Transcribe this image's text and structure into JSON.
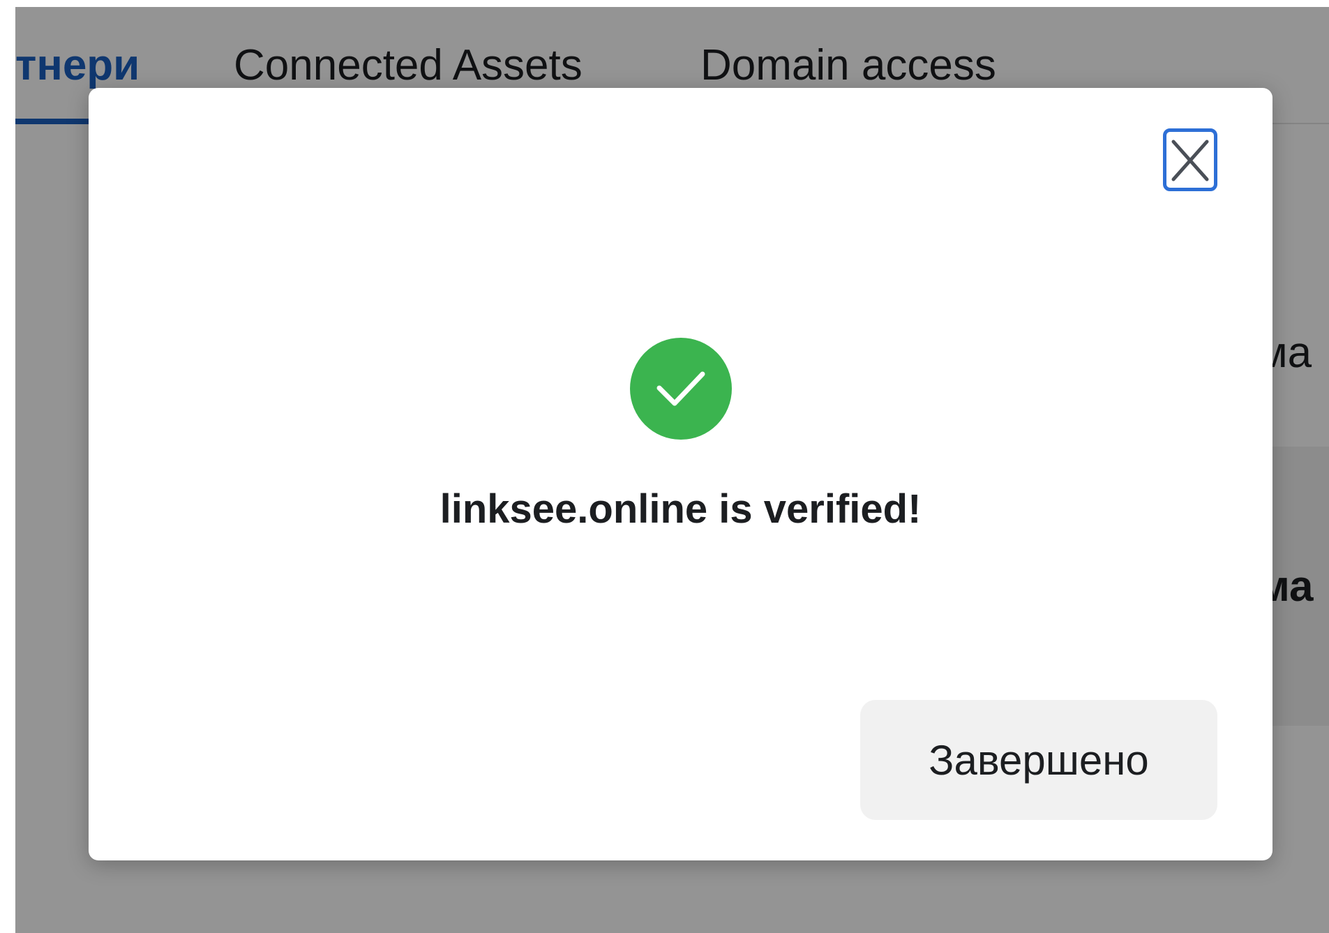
{
  "tabs": [
    {
      "label": "тнери",
      "active": true
    },
    {
      "label": "Connected Assets",
      "active": false
    },
    {
      "label": "Domain access",
      "active": false
    }
  ],
  "background": {
    "row1_text": "ма",
    "row2_text": "ма"
  },
  "modal": {
    "close_icon": "close-icon",
    "status_icon": "check-circle-icon",
    "message": "linksee.online is verified!",
    "done_label": "Завершено"
  },
  "colors": {
    "accent": "#1a5fc0",
    "success": "#3bb44f",
    "focus_ring": "#2d6fd6",
    "button_bg": "#f1f1f1"
  }
}
